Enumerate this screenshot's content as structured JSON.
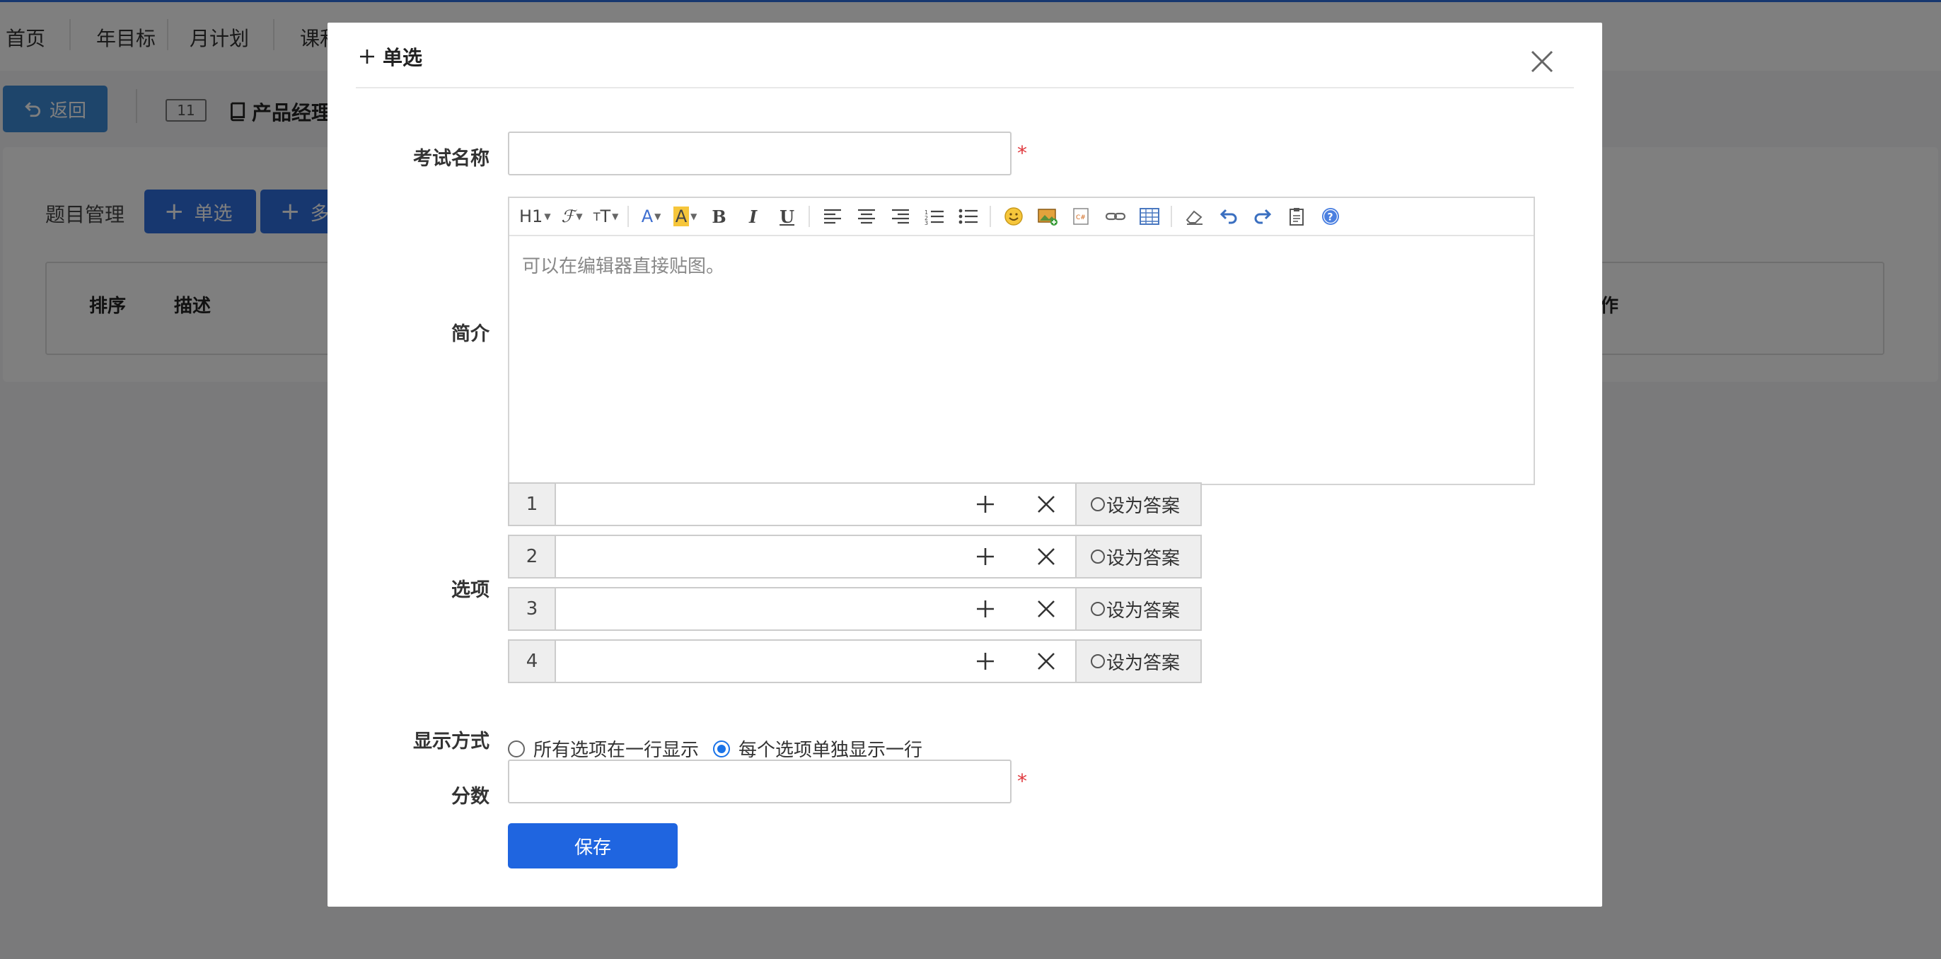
{
  "nav": {
    "items": [
      "首页",
      "年目标",
      "月计划",
      "课和"
    ]
  },
  "toolbar": {
    "back_label": "返回",
    "count": "11",
    "title": "产品经理"
  },
  "panel": {
    "label": "题目管理",
    "btn_single": "单选",
    "btn_multi": "多",
    "columns": [
      "排序",
      "描述",
      "作"
    ]
  },
  "modal": {
    "title": "单选",
    "fields": {
      "exam_name": {
        "label": "考试名称",
        "value": "",
        "required_mark": "*"
      },
      "intro": {
        "label": "简介",
        "placeholder": "可以在编辑器直接贴图。",
        "toolbar": [
          "heading-icon",
          "font-family-icon",
          "font-size-icon",
          "font-color-icon",
          "highlight-icon",
          "bold-icon",
          "italic-icon",
          "underline-icon",
          "align-left-icon",
          "align-center-icon",
          "align-right-icon",
          "ordered-list-icon",
          "unordered-list-icon",
          "emoji-icon",
          "image-icon",
          "code-icon",
          "link-icon",
          "table-icon",
          "eraser-icon",
          "undo-icon",
          "redo-icon",
          "paste-icon",
          "help-icon"
        ]
      },
      "options": {
        "label": "选项",
        "items": [
          {
            "num": "1",
            "value": "",
            "answer_label": "设为答案"
          },
          {
            "num": "2",
            "value": "",
            "answer_label": "设为答案"
          },
          {
            "num": "3",
            "value": "",
            "answer_label": "设为答案"
          },
          {
            "num": "4",
            "value": "",
            "answer_label": "设为答案"
          }
        ]
      },
      "display": {
        "label": "显示方式",
        "choices": [
          "所有选项在一行显示",
          "每个选项单独显示一行"
        ],
        "selected": "每个选项单独显示一行"
      },
      "score": {
        "label": "分数",
        "value": "",
        "required_mark": "*"
      }
    },
    "save_label": "保存"
  }
}
